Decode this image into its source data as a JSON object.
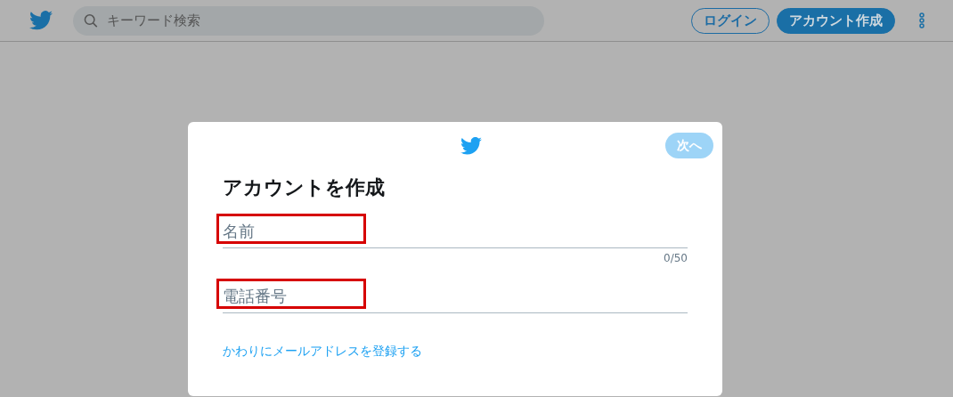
{
  "header": {
    "search": {
      "placeholder": "キーワード検索"
    },
    "buttons": [
      {
        "label": "ログイン",
        "kind": "outline"
      },
      {
        "label": "アカウント作成",
        "kind": "filled"
      }
    ]
  },
  "dialog": {
    "next_button": {
      "label": "次へ",
      "disabled": true
    },
    "title": "アカウントを作成",
    "fields": [
      {
        "placeholder": "名前",
        "highlighted": true,
        "counter": "0/50"
      },
      {
        "placeholder": "電話番号",
        "highlighted": true
      }
    ],
    "link": "かわりにメールアドレスを登録する"
  }
}
